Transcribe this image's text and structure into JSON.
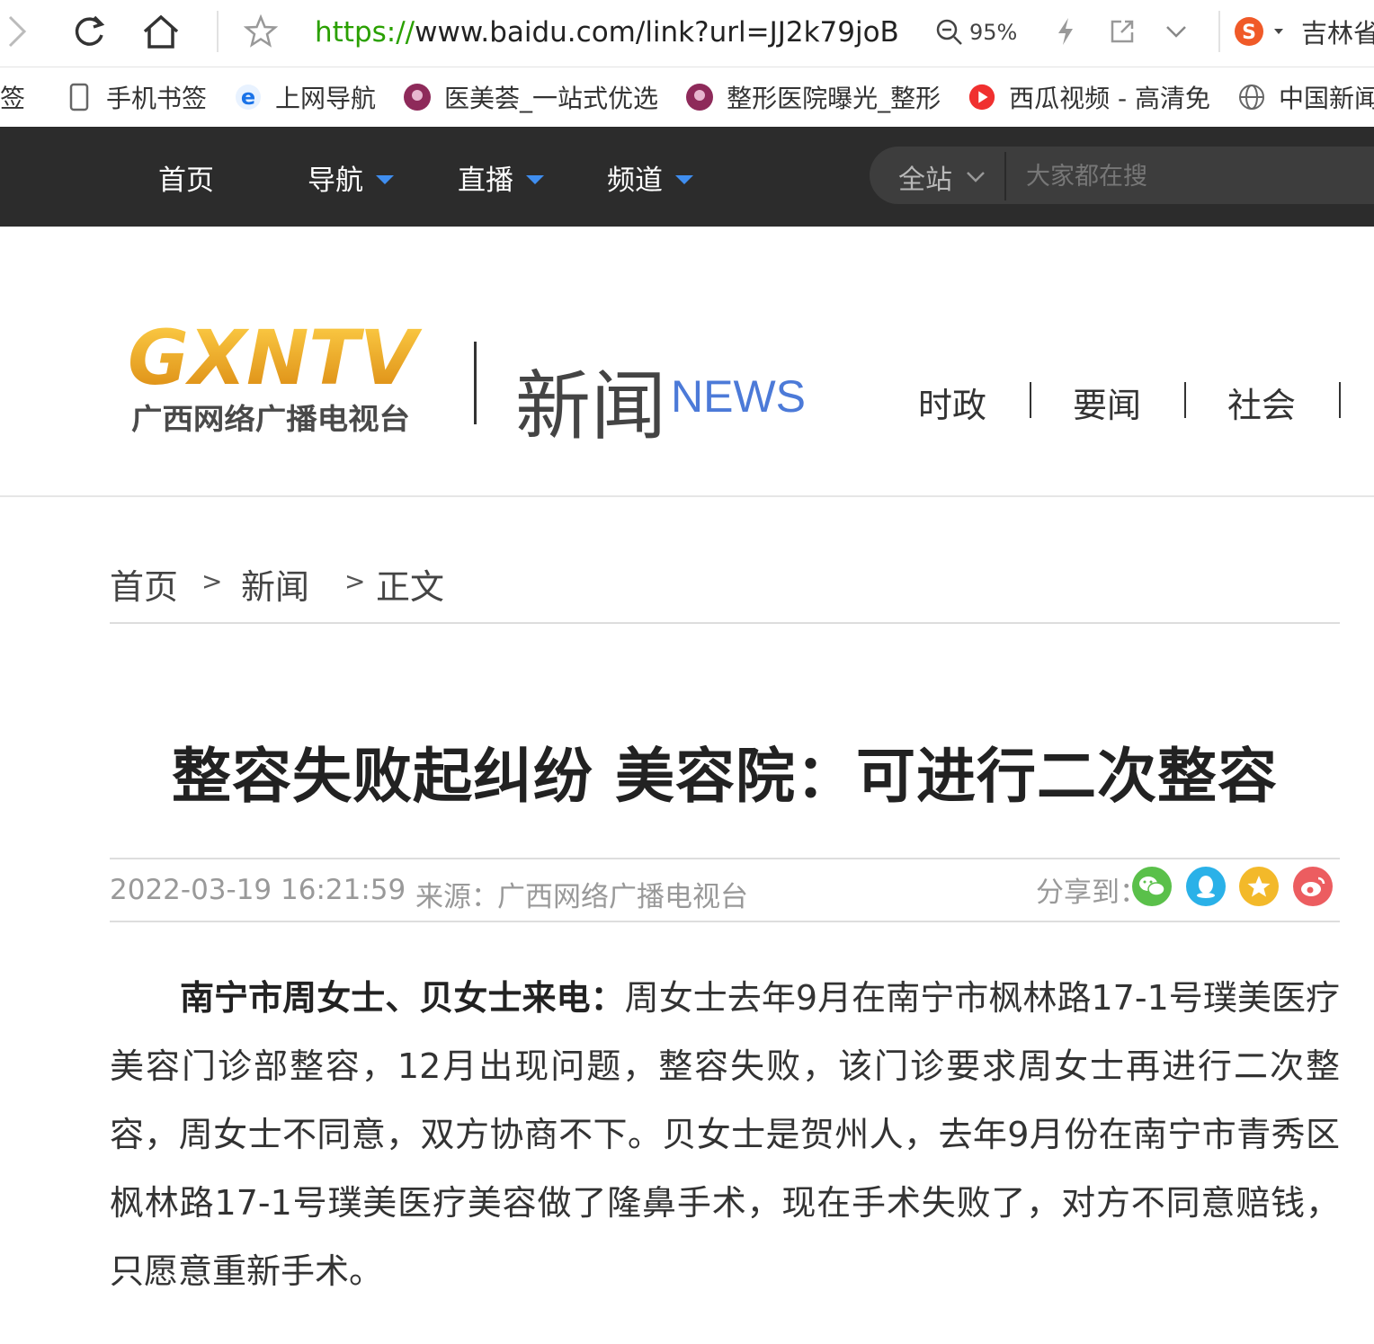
{
  "browser": {
    "url_scheme": "https://",
    "url_rest": "www.baidu.com/link?url=JJ2k79joB",
    "zoom": "95%",
    "profile_text": "吉林省",
    "bookmarks": [
      {
        "label": "签",
        "icon": "none"
      },
      {
        "label": "手机书签",
        "icon": "phone-icon"
      },
      {
        "label": "上网导航",
        "icon": "ie-icon"
      },
      {
        "label": "医美荟_一站式优选",
        "icon": "yimeihui-icon"
      },
      {
        "label": "整形医院曝光_整形",
        "icon": "yimeihui-icon"
      },
      {
        "label": "西瓜视频 - 高清免",
        "icon": "xigua-icon"
      },
      {
        "label": "中国新闻网_权",
        "icon": "globe-icon"
      }
    ]
  },
  "site_nav": {
    "items": [
      "首页",
      "导航",
      "直播",
      "频道"
    ],
    "search_scope": "全站",
    "search_placeholder": "大家都在搜"
  },
  "header": {
    "logo_text": "GXNTV",
    "logo_sub": "广西网络广播电视台",
    "brand_cn": "新闻",
    "brand_en": "NEWS",
    "categories": [
      "时政",
      "要闻",
      "社会"
    ]
  },
  "breadcrumb": {
    "items": [
      "首页",
      "新闻",
      "正文"
    ],
    "separator": ">"
  },
  "article": {
    "title": "整容失败起纠纷 美容院：可进行二次整容",
    "date": "2022-03-19 16:21:59",
    "source_label": "来源：",
    "source": "广西网络广播电视台",
    "share_label": "分享到：",
    "share_targets": [
      "wechat-icon",
      "qq-icon",
      "qzone-icon",
      "weibo-icon"
    ],
    "lead": "南宁市周女士、贝女士来电：",
    "body": "周女士去年9月在南宁市枫林路17-1号璞美医疗美容门诊部整容，12月出现问题，整容失败，该门诊要求周女士再进行二次整容，周女士不同意，双方协商不下。贝女士是贺州人，去年9月份在南宁市青秀区枫林路17-1号璞美医疗美容做了隆鼻手术，现在手术失败了，对方不同意赔钱，只愿意重新手术。"
  },
  "colors": {
    "nav_bg": "#2c2c2c",
    "accent_blue": "#3f8ef0",
    "brand_blue": "#4c7ad8",
    "url_green": "#2aa000",
    "logo_gold": "#e8a21a"
  }
}
